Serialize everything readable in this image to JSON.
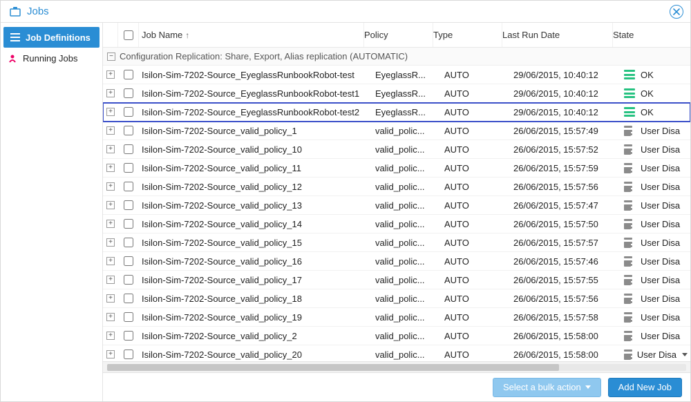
{
  "window": {
    "title": "Jobs"
  },
  "sidebar": {
    "items": [
      {
        "label": "Job Definitions",
        "icon": "list-icon",
        "active": true
      },
      {
        "label": "Running Jobs",
        "icon": "running-icon",
        "active": false
      }
    ]
  },
  "table": {
    "columns": {
      "name": "Job Name",
      "policy": "Policy",
      "type": "Type",
      "last": "Last Run Date",
      "state": "State"
    },
    "sort_column": "name",
    "sort_dir": "asc",
    "group": {
      "label": "Configuration Replication: Share, Export, Alias replication (AUTOMATIC)"
    },
    "rows": [
      {
        "name": "Isilon-Sim-7202-Source_EyeglassRunbookRobot-test",
        "policy": "EyeglassR...",
        "type": "AUTO",
        "last": "29/06/2015, 10:40:12",
        "state_label": "OK",
        "state_kind": "ok",
        "selected": false
      },
      {
        "name": "Isilon-Sim-7202-Source_EyeglassRunbookRobot-test1",
        "policy": "EyeglassR...",
        "type": "AUTO",
        "last": "29/06/2015, 10:40:12",
        "state_label": "OK",
        "state_kind": "ok",
        "selected": false
      },
      {
        "name": "Isilon-Sim-7202-Source_EyeglassRunbookRobot-test2",
        "policy": "EyeglassR...",
        "type": "AUTO",
        "last": "29/06/2015, 10:40:12",
        "state_label": "OK",
        "state_kind": "ok",
        "selected": true
      },
      {
        "name": "Isilon-Sim-7202-Source_valid_policy_1",
        "policy": "valid_polic...",
        "type": "AUTO",
        "last": "26/06/2015, 15:57:49",
        "state_label": "User Disa",
        "state_kind": "warn",
        "selected": false
      },
      {
        "name": "Isilon-Sim-7202-Source_valid_policy_10",
        "policy": "valid_polic...",
        "type": "AUTO",
        "last": "26/06/2015, 15:57:52",
        "state_label": "User Disa",
        "state_kind": "warn",
        "selected": false
      },
      {
        "name": "Isilon-Sim-7202-Source_valid_policy_11",
        "policy": "valid_polic...",
        "type": "AUTO",
        "last": "26/06/2015, 15:57:59",
        "state_label": "User Disa",
        "state_kind": "warn",
        "selected": false
      },
      {
        "name": "Isilon-Sim-7202-Source_valid_policy_12",
        "policy": "valid_polic...",
        "type": "AUTO",
        "last": "26/06/2015, 15:57:56",
        "state_label": "User Disa",
        "state_kind": "warn",
        "selected": false
      },
      {
        "name": "Isilon-Sim-7202-Source_valid_policy_13",
        "policy": "valid_polic...",
        "type": "AUTO",
        "last": "26/06/2015, 15:57:47",
        "state_label": "User Disa",
        "state_kind": "warn",
        "selected": false
      },
      {
        "name": "Isilon-Sim-7202-Source_valid_policy_14",
        "policy": "valid_polic...",
        "type": "AUTO",
        "last": "26/06/2015, 15:57:50",
        "state_label": "User Disa",
        "state_kind": "warn",
        "selected": false
      },
      {
        "name": "Isilon-Sim-7202-Source_valid_policy_15",
        "policy": "valid_polic...",
        "type": "AUTO",
        "last": "26/06/2015, 15:57:57",
        "state_label": "User Disa",
        "state_kind": "warn",
        "selected": false
      },
      {
        "name": "Isilon-Sim-7202-Source_valid_policy_16",
        "policy": "valid_polic...",
        "type": "AUTO",
        "last": "26/06/2015, 15:57:46",
        "state_label": "User Disa",
        "state_kind": "warn",
        "selected": false
      },
      {
        "name": "Isilon-Sim-7202-Source_valid_policy_17",
        "policy": "valid_polic...",
        "type": "AUTO",
        "last": "26/06/2015, 15:57:55",
        "state_label": "User Disa",
        "state_kind": "warn",
        "selected": false
      },
      {
        "name": "Isilon-Sim-7202-Source_valid_policy_18",
        "policy": "valid_polic...",
        "type": "AUTO",
        "last": "26/06/2015, 15:57:56",
        "state_label": "User Disa",
        "state_kind": "warn",
        "selected": false
      },
      {
        "name": "Isilon-Sim-7202-Source_valid_policy_19",
        "policy": "valid_polic...",
        "type": "AUTO",
        "last": "26/06/2015, 15:57:58",
        "state_label": "User Disa",
        "state_kind": "warn",
        "selected": false
      },
      {
        "name": "Isilon-Sim-7202-Source_valid_policy_2",
        "policy": "valid_polic...",
        "type": "AUTO",
        "last": "26/06/2015, 15:58:00",
        "state_label": "User Disa",
        "state_kind": "warn",
        "selected": false
      },
      {
        "name": "Isilon-Sim-7202-Source_valid_policy_20",
        "policy": "valid_polic...",
        "type": "AUTO",
        "last": "26/06/2015, 15:58:00",
        "state_label": "User Disa",
        "state_kind": "warn",
        "selected": false
      }
    ]
  },
  "footer": {
    "bulk_label": "Select a bulk action",
    "add_label": "Add New Job"
  }
}
